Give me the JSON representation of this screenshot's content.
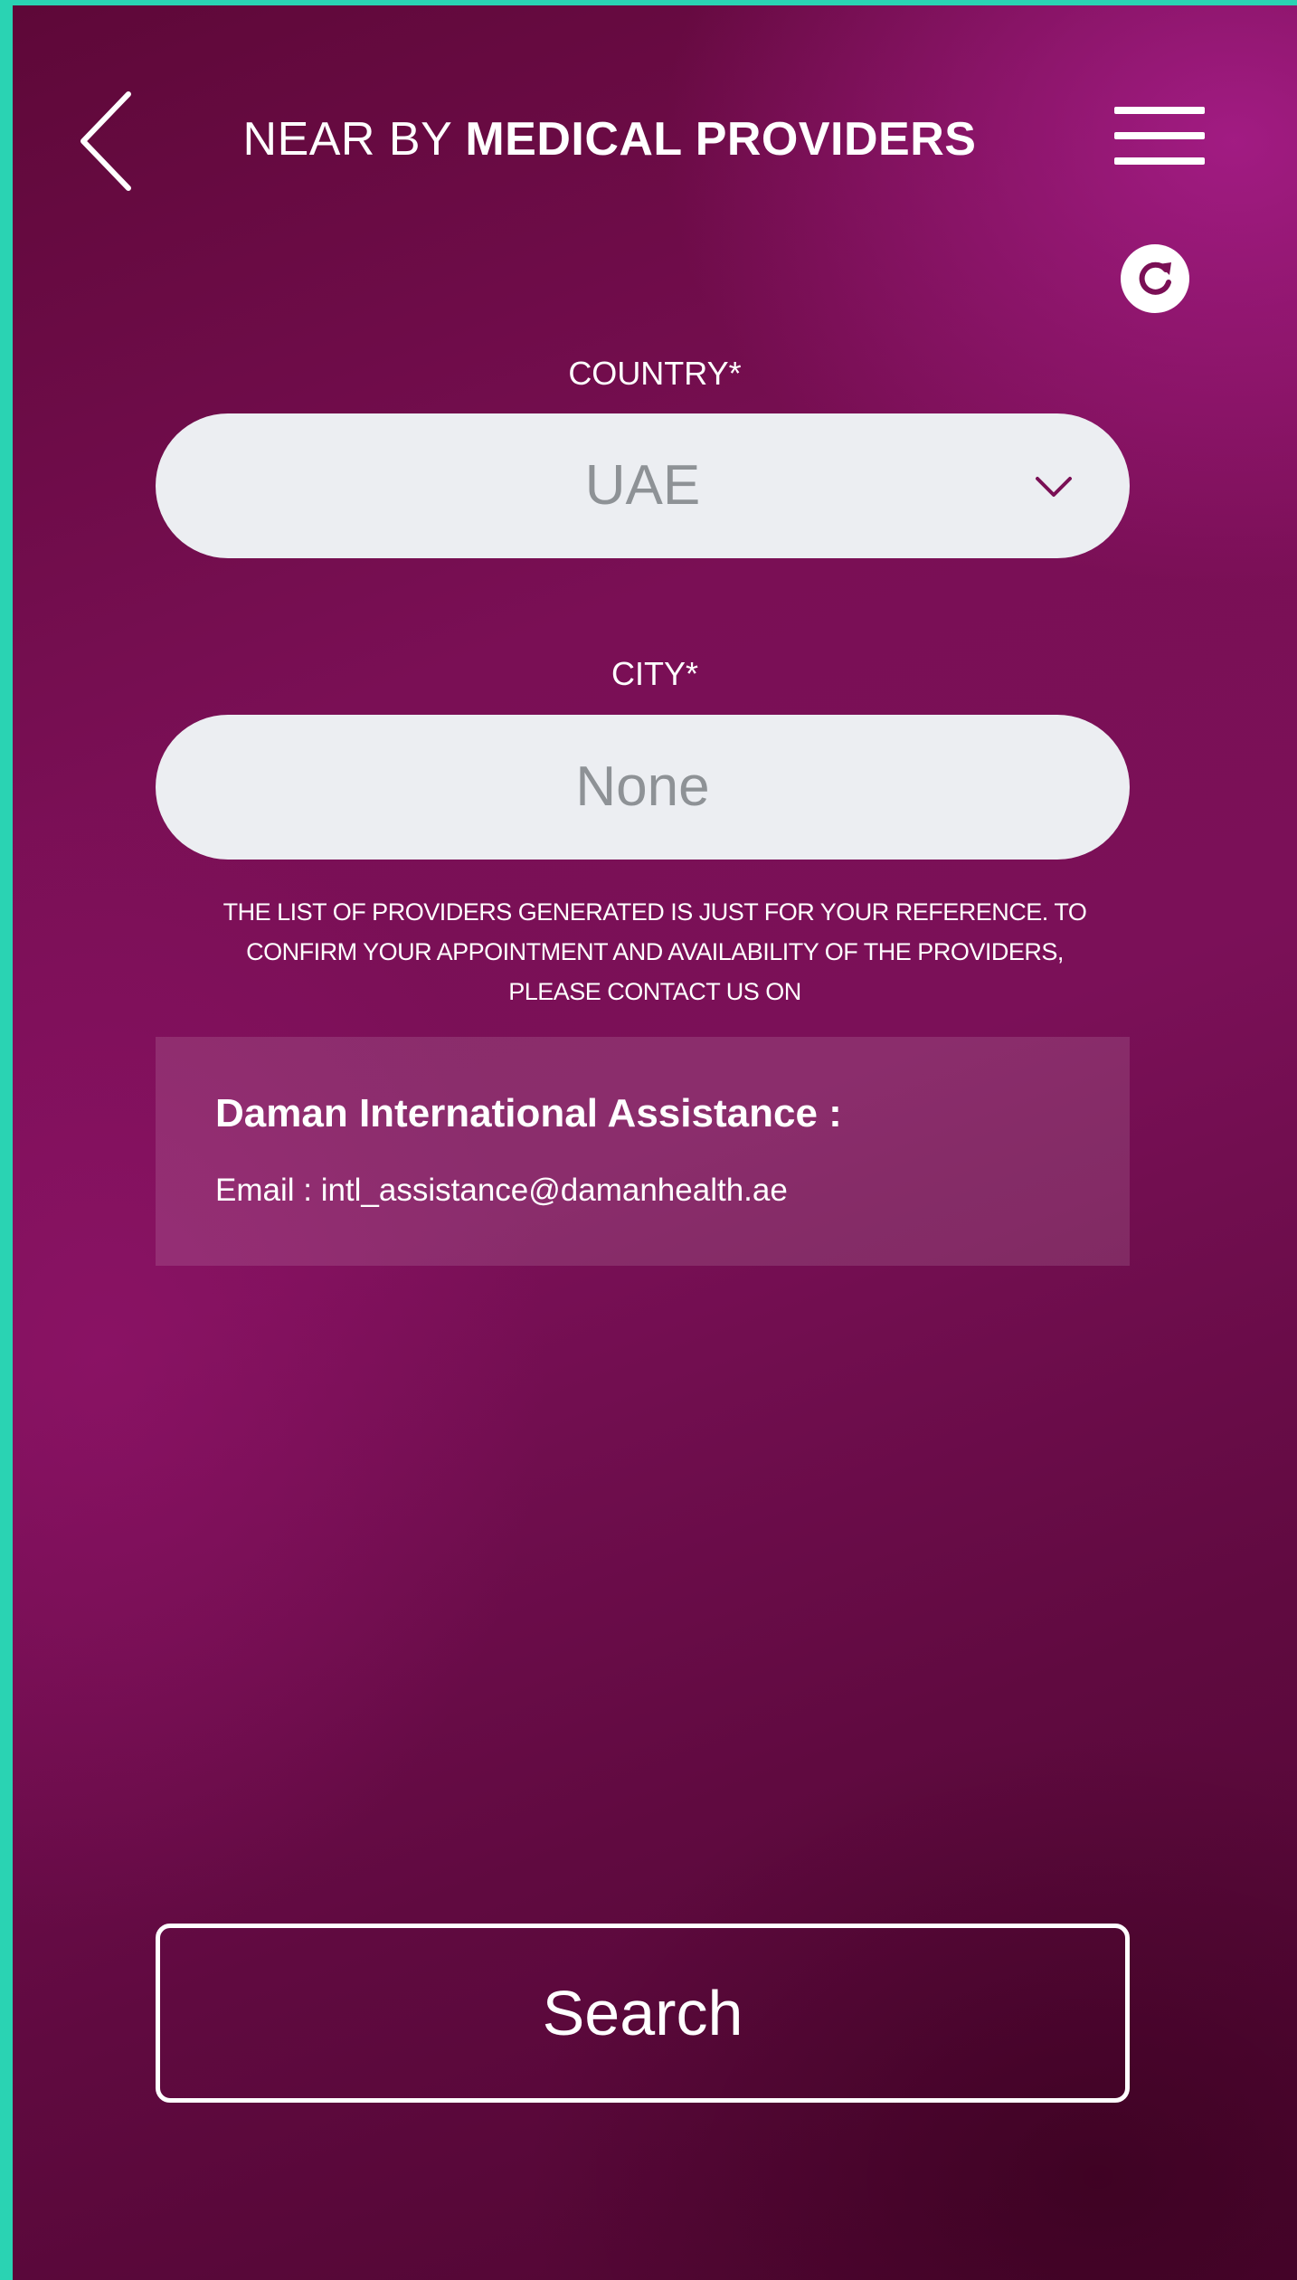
{
  "header": {
    "title_light": "NEAR BY ",
    "title_bold": "MEDICAL PROVIDERS",
    "back_icon": "chevron-left-icon",
    "menu_icon": "hamburger-menu-icon",
    "refresh_icon": "refresh-icon"
  },
  "form": {
    "country_label": "COUNTRY*",
    "country_value": "UAE",
    "city_label": "CITY*",
    "city_value": "None"
  },
  "disclaimer": {
    "line1": "THE LIST OF PROVIDERS GENERATED IS JUST FOR YOUR REFERENCE. TO",
    "line2": "CONFIRM YOUR APPOINTMENT AND AVAILABILITY OF THE PROVIDERS,",
    "line3": "PLEASE CONTACT US ON"
  },
  "contact": {
    "name": "Daman International Assistance :",
    "email": "Email : intl_assistance@damanhealth.ae"
  },
  "actions": {
    "search_label": "Search"
  },
  "colors": {
    "frame": "#2ad3b3",
    "background_primary": "#7a0f55",
    "field_background": "#eceef2",
    "text_primary": "#ffffff"
  }
}
